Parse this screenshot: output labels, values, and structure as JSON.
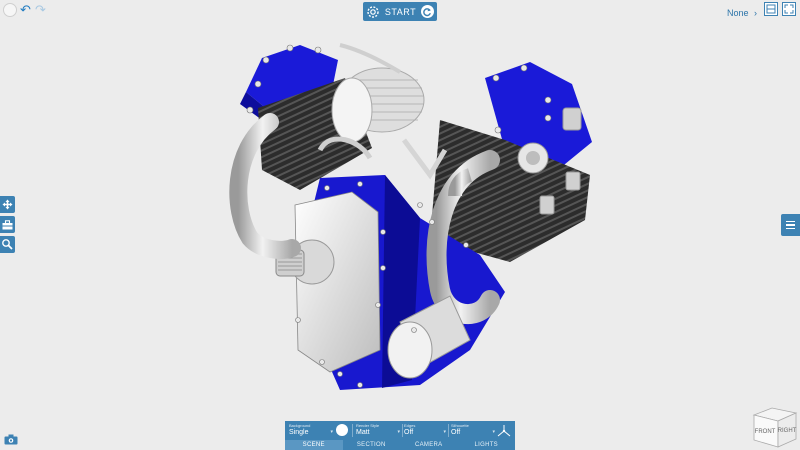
{
  "top": {
    "start_label": "START",
    "view_selector_value": "None",
    "view_selector_chevron": "›"
  },
  "icons": {
    "undo": "undo-icon",
    "redo": "redo-icon",
    "start": "settings-wheel-icon",
    "refresh": "refresh-icon",
    "move": "move-icon",
    "toolbox": "toolbox-icon",
    "wrench": "wrench-icon",
    "menu": "hamburger-menu-icon",
    "camera": "camera-icon"
  },
  "scene_panel": {
    "settings": [
      {
        "label": "Background",
        "value": "Single"
      },
      {
        "label": "Render Style",
        "value": "Matt"
      },
      {
        "label": "Edges",
        "value": "Off"
      },
      {
        "label": "Silhouette",
        "value": "Off"
      }
    ],
    "tabs": [
      "SCENE",
      "SECTION",
      "CAMERA",
      "LIGHTS"
    ],
    "active_tab": "SCENE"
  },
  "view_cube": {
    "front_label": "FRONT",
    "right_label": "RIGHT"
  },
  "colors": {
    "accent": "#3d82b3",
    "background": "#ececec",
    "engine_body": "#1010d0",
    "engine_fin": "#2a2a2a",
    "engine_metal": "#dcdcdc"
  }
}
